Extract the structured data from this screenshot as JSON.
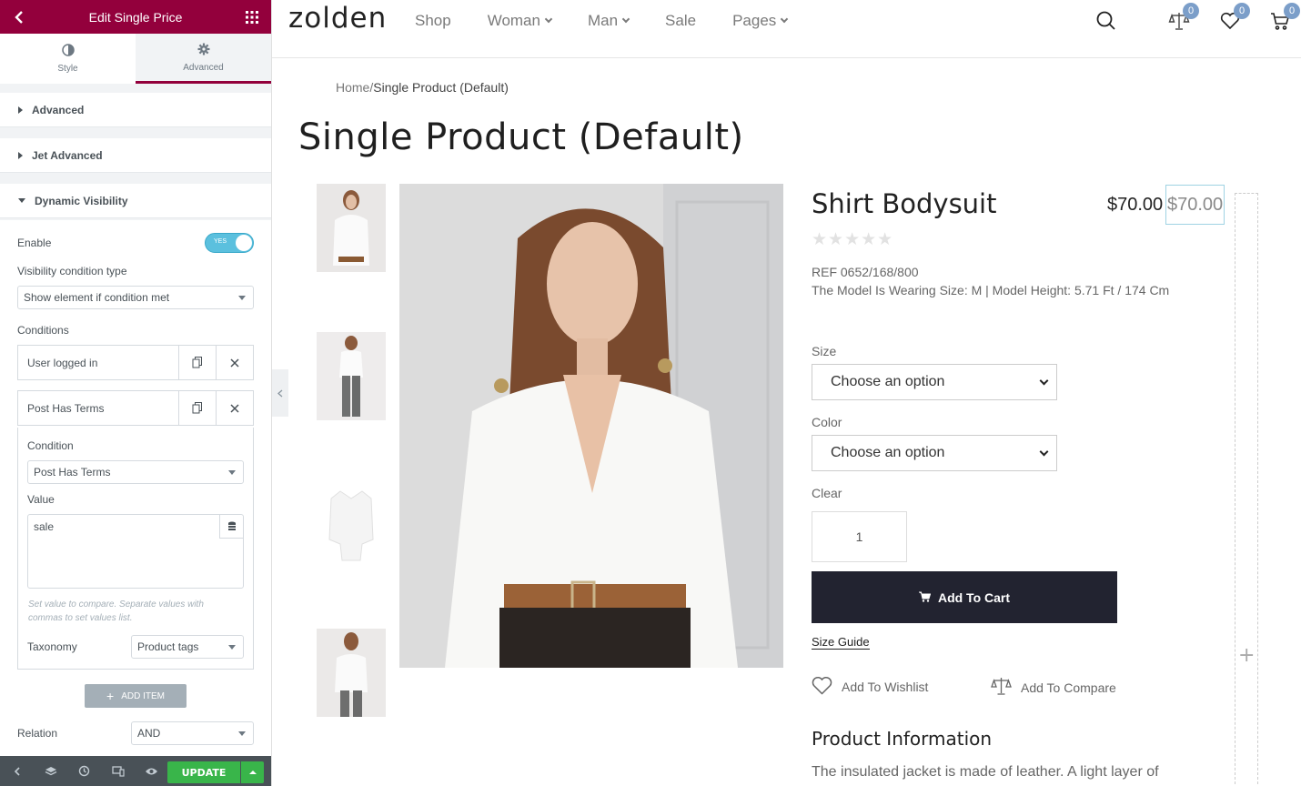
{
  "panel": {
    "title": "Edit Single Price",
    "tabs": [
      {
        "label": "Style"
      },
      {
        "label": "Advanced"
      }
    ],
    "sections": [
      {
        "label": "Advanced"
      },
      {
        "label": "Jet Advanced"
      },
      {
        "label": "Dynamic Visibility"
      }
    ],
    "dv": {
      "enable_label": "Enable",
      "toggle_text": "YES",
      "type_label": "Visibility condition type",
      "type_value": "Show element if condition met",
      "conditions_label": "Conditions",
      "conditions": [
        {
          "title": "User logged in"
        },
        {
          "title": "Post Has Terms"
        }
      ],
      "condition_label": "Condition",
      "condition_value": "Post Has Terms",
      "value_label": "Value",
      "value_text": "sale",
      "hint": "Set value to compare. Separate values with commas to set values list.",
      "taxonomy_label": "Taxonomy",
      "taxonomy_value": "Product tags",
      "add_item": "ADD ITEM",
      "relation_label": "Relation",
      "relation_value": "AND"
    },
    "footer": {
      "update": "UPDATE"
    }
  },
  "site": {
    "logo": "zolden",
    "nav": [
      {
        "label": "Shop",
        "dropdown": false
      },
      {
        "label": "Woman",
        "dropdown": true
      },
      {
        "label": "Man",
        "dropdown": true
      },
      {
        "label": "Sale",
        "dropdown": false
      },
      {
        "label": "Pages",
        "dropdown": true
      }
    ],
    "badges": {
      "compare": "0",
      "wishlist": "0",
      "cart": "0"
    },
    "accent": "#7b9ec9"
  },
  "breadcrumb": {
    "home": "Home",
    "sep": "/",
    "current": "Single Product (Default)"
  },
  "page_title": "Single Product (Default)",
  "product": {
    "name": "Shirt Bodysuit",
    "price": "$70.00",
    "price_selected": "$70.00",
    "stars": "★★★★★",
    "ref": "REF 0652/168/800",
    "model_info": "The Model Is Wearing Size: M | Model Height: 5.71 Ft / 174 Cm",
    "size_label": "Size",
    "size_value": "Choose an option",
    "color_label": "Color",
    "color_value": "Choose an option",
    "clear": "Clear",
    "qty": "1",
    "add_to_cart": "Add To Cart",
    "size_guide": "Size Guide",
    "wishlist": "Add To Wishlist",
    "compare": "Add To Compare",
    "info_title": "Product Information",
    "info_text": "The insulated jacket is made of leather. A light layer of"
  },
  "colors": {
    "panel_brand": "#93003c",
    "update_green": "#39b54a",
    "cart_button": "#222330"
  }
}
